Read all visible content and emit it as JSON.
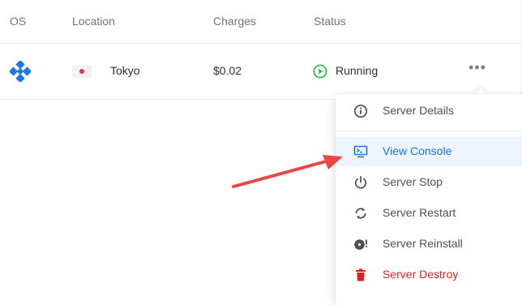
{
  "table": {
    "headers": {
      "os": "OS",
      "location": "Location",
      "charges": "Charges",
      "status": "Status"
    },
    "row": {
      "os_icon": "os-logo-icon",
      "location": "Tokyo",
      "flag_icon": "japan-flag-icon",
      "charges": "$0.02",
      "status": "Running",
      "status_icon": "play-circle-icon",
      "more_icon": "more-horizontal-icon",
      "more_label": "•••"
    }
  },
  "menu": {
    "items": [
      {
        "label": "Server Details",
        "icon": "info-icon"
      },
      {
        "label": "View Console",
        "icon": "console-icon",
        "active": true
      },
      {
        "label": "Server Stop",
        "icon": "power-icon"
      },
      {
        "label": "Server Restart",
        "icon": "restart-icon"
      },
      {
        "label": "Server Reinstall",
        "icon": "reinstall-icon"
      },
      {
        "label": "Server Destroy",
        "icon": "trash-icon",
        "danger": true
      }
    ]
  },
  "colors": {
    "accent": "#1a73e8",
    "active_bg": "#eef4fd",
    "running": "#2fbf4a",
    "danger": "#e01f1f",
    "annotation_arrow": "#e94646",
    "os_logo": "#1f74e6"
  }
}
